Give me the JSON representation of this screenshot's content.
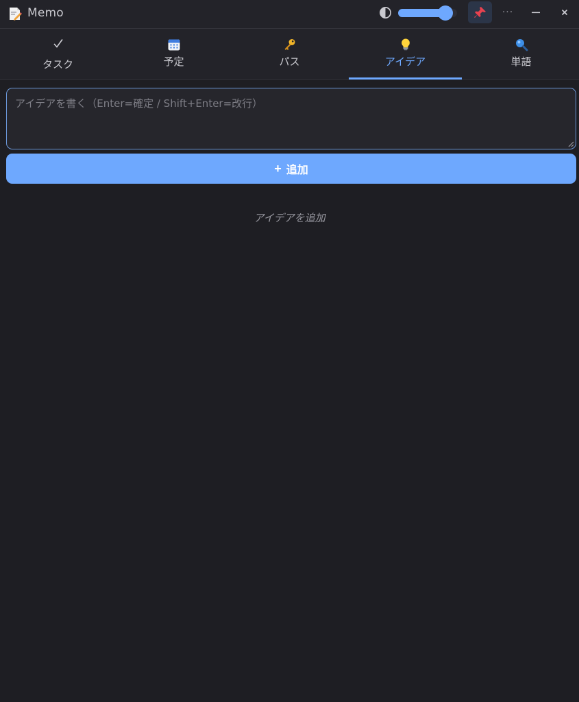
{
  "app": {
    "title": "Memo"
  },
  "opacity_slider": {
    "value": 0.9
  },
  "tabs": [
    {
      "label": "タスク",
      "icon": "checkmark-icon"
    },
    {
      "label": "予定",
      "icon": "calendar-icon"
    },
    {
      "label": "パス",
      "icon": "key-icon"
    },
    {
      "label": "アイデア",
      "icon": "lightbulb-icon",
      "active": true
    },
    {
      "label": "単語",
      "icon": "magnifier-icon"
    }
  ],
  "input": {
    "placeholder": "アイデアを書く（Enter=確定 / Shift+Enter=改行）",
    "value": ""
  },
  "add_button": {
    "plus": "+",
    "label": "追加"
  },
  "empty_state": "アイデアを追加",
  "colors": {
    "accent": "#6ea8fe",
    "background": "#1e1e23",
    "bar": "#232329"
  }
}
